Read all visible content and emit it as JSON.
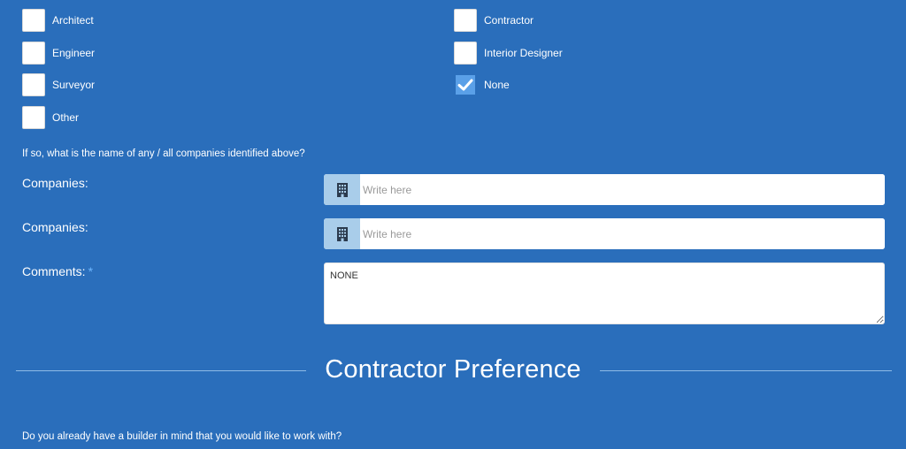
{
  "colors": {
    "background": "#2a6ebb",
    "accent": "#6cb6ff",
    "checked_box": "#5aa0e8",
    "icon_addon": "#a9cdea"
  },
  "roles": [
    {
      "label": "Architect",
      "checked": false
    },
    {
      "label": "Engineer",
      "checked": false
    },
    {
      "label": "Surveyor",
      "checked": false
    },
    {
      "label": "Other",
      "checked": false
    },
    {
      "label": "Contractor",
      "checked": false
    },
    {
      "label": "Interior Designer",
      "checked": false
    },
    {
      "label": "None",
      "checked": true
    }
  ],
  "companies_question": "If so, what is the name of any / all companies identified above?",
  "fields": {
    "companies_1": {
      "label": "Companies:",
      "placeholder": "Write here",
      "value": "",
      "icon": "building-icon"
    },
    "companies_2": {
      "label": "Companies:",
      "placeholder": "Write here",
      "value": "",
      "icon": "building-icon"
    },
    "comments": {
      "label": "Comments:",
      "required_marker": "*",
      "value": "NONE"
    }
  },
  "section": {
    "title": "Contractor Preference"
  },
  "builder_question": "Do you already have a builder in mind that you would like to work with?"
}
